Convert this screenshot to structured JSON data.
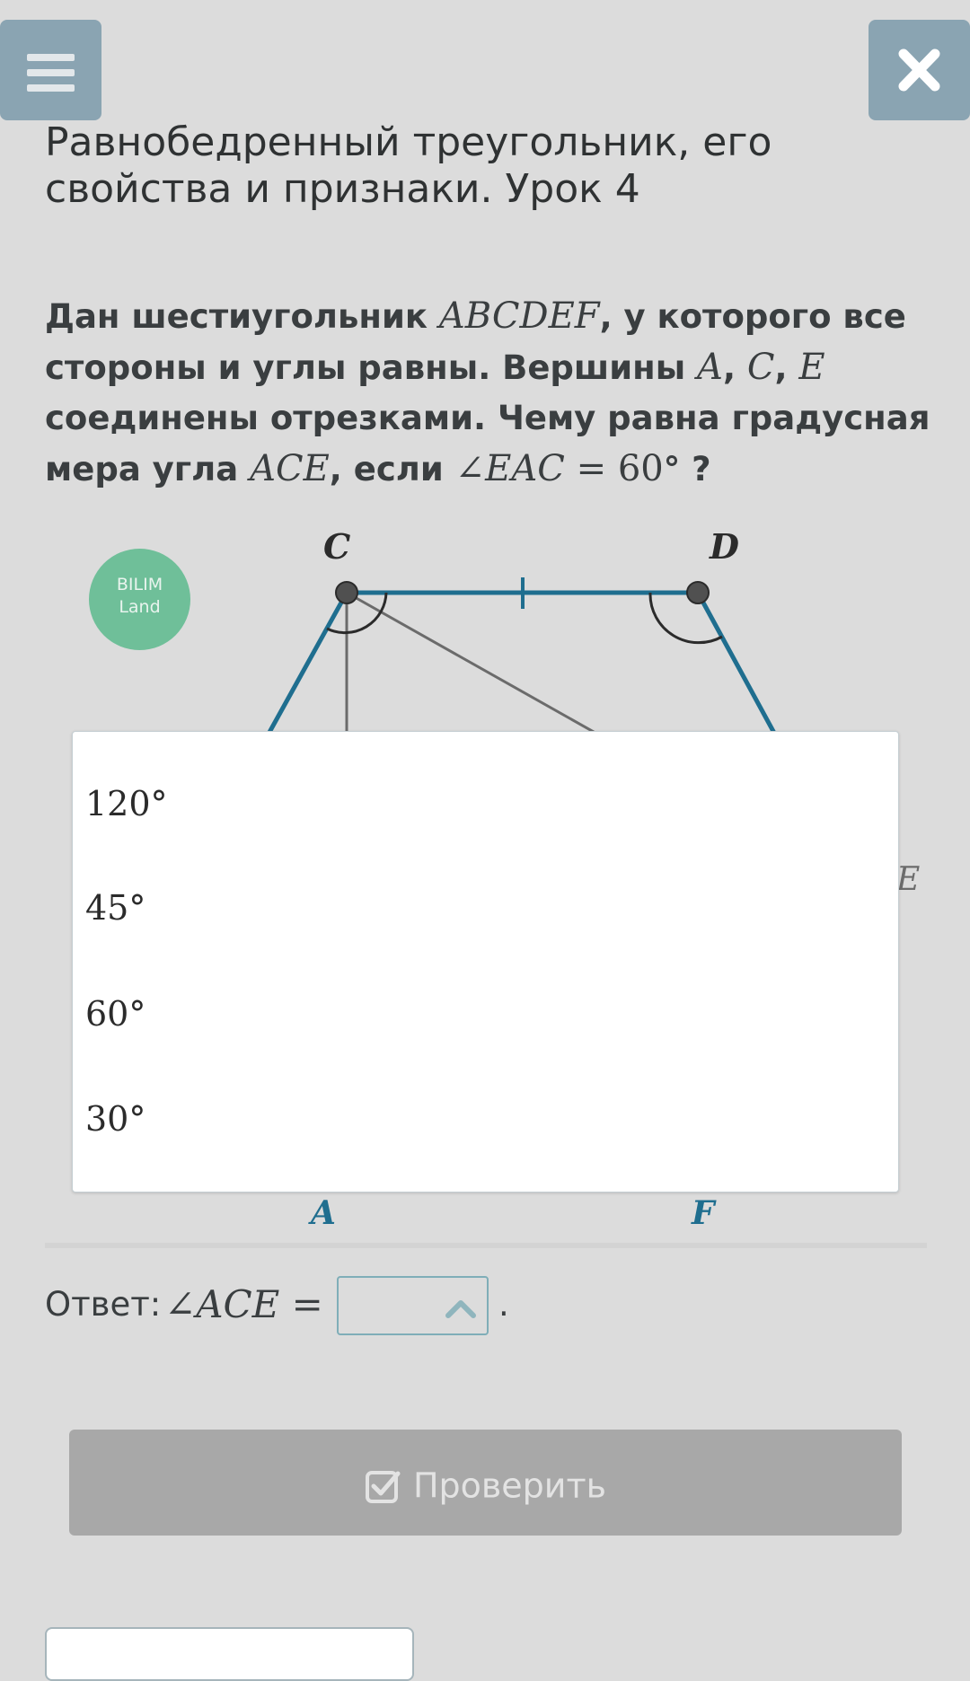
{
  "header": {
    "menu_icon": "hamburger-icon",
    "close_icon": "close-icon",
    "button_color": "#8aa4b2"
  },
  "lesson": {
    "title_line1": "Равнобедренный треугольник, его",
    "title_line2": "свойства и признаки. Урок 4"
  },
  "question": {
    "t1": "Дан шестиугольник ",
    "m1": "ABCDEF",
    "t2": ", у которого все",
    "t3": "стороны и углы равны. Вершины ",
    "m2": "A",
    "t4": ", ",
    "m3": "C",
    "t5": ", ",
    "m4": "E",
    "t6": "соединены отрезками. Чему равна градусная",
    "t7": "мера угла ",
    "m5": "ACE",
    "t8": ", если ",
    "m6": "∠EAC",
    "m7": " = 60",
    "t9": "° ?"
  },
  "figure": {
    "logo_line1": "BILIM",
    "logo_line2": "Land",
    "logo_color": "#6fbf99",
    "side_color": "#1f6e8f",
    "vertices": {
      "c": "C",
      "d": "D",
      "e": "E",
      "a": "A",
      "f": "F"
    }
  },
  "dropdown": {
    "options": [
      "120°",
      "45°",
      "60°",
      "30°"
    ]
  },
  "answer": {
    "label": "Ответ: ",
    "expression": "∠ACE =",
    "selected": "",
    "chevron_icon": "chevron-up-icon",
    "dot": "."
  },
  "check_button": {
    "label": "Проверить",
    "icon": "check-square-icon"
  }
}
